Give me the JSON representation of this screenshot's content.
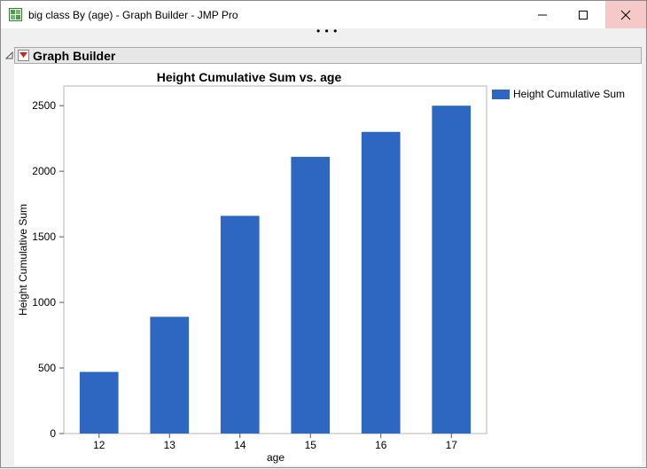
{
  "window": {
    "title": "big class By (age) - Graph Builder - JMP Pro",
    "more_dots": "• • •"
  },
  "outline": {
    "title": "Graph Builder"
  },
  "legend": {
    "label": "Height Cumulative Sum",
    "color": "#2e67c1"
  },
  "colors": {
    "bar": "#2e67c1",
    "close_button_bg": "#f6c9c9"
  },
  "chart_data": {
    "type": "bar",
    "title": "Height Cumulative Sum vs. age",
    "xlabel": "age",
    "ylabel": "Height Cumulative Sum",
    "categories": [
      "12",
      "13",
      "14",
      "15",
      "16",
      "17"
    ],
    "series": [
      {
        "name": "Height Cumulative Sum",
        "values": [
          470,
          890,
          1660,
          2110,
          2300,
          2500
        ]
      }
    ],
    "ylim": [
      0,
      2650
    ],
    "yticks": [
      0,
      500,
      1000,
      1500,
      2000,
      2500
    ],
    "grid": false,
    "legend_position": "right"
  }
}
